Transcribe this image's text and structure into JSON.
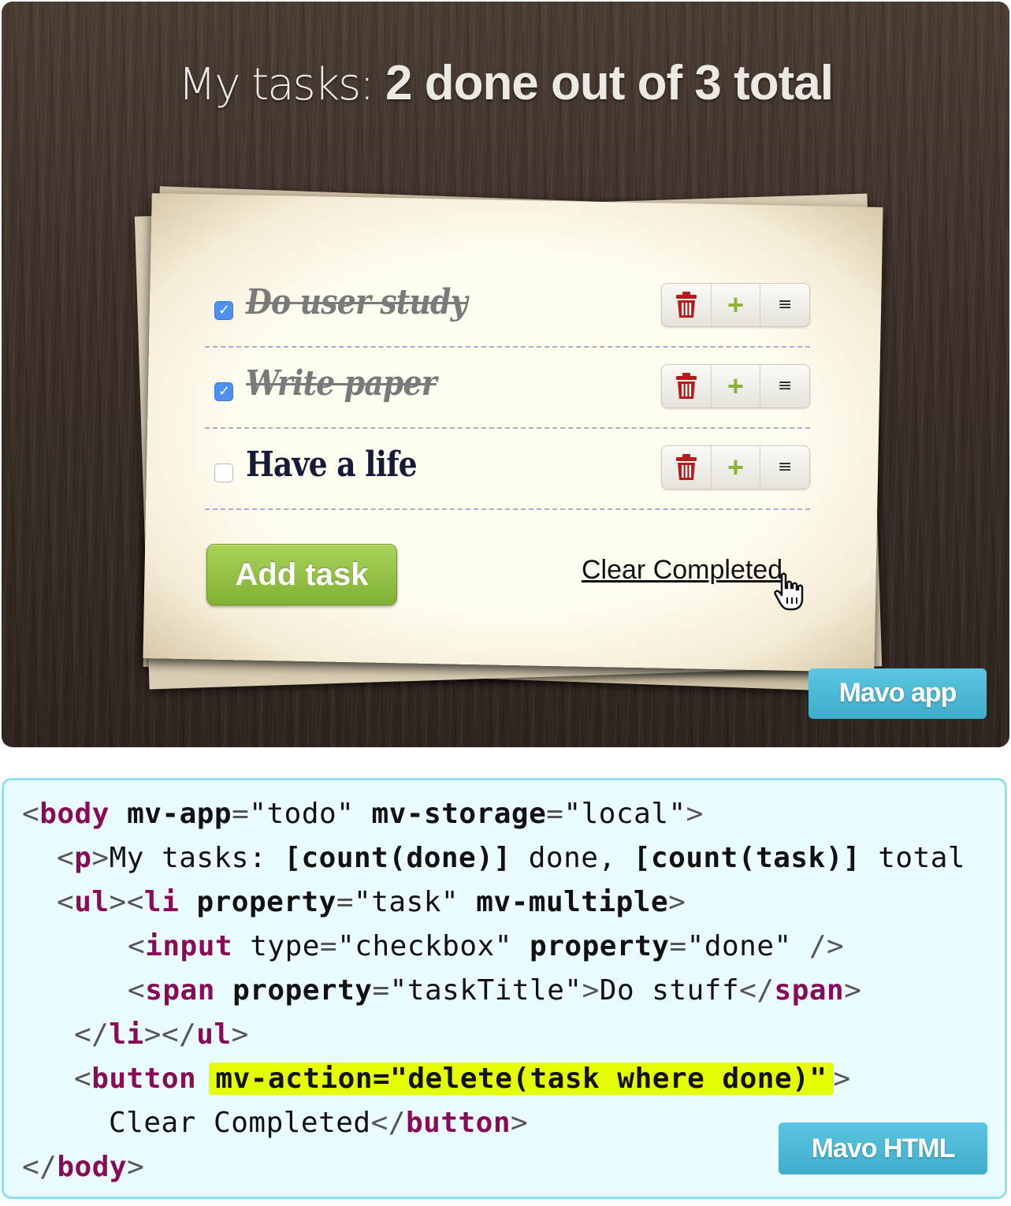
{
  "app": {
    "headline": {
      "prefix": "My tasks: ",
      "done_count": "2",
      "middle": " done out of ",
      "total_count": "3",
      "suffix": " total"
    },
    "tasks": [
      {
        "title": "Do user study",
        "done": true
      },
      {
        "title": "Write paper",
        "done": true
      },
      {
        "title": "Have a life",
        "done": false
      }
    ],
    "task_actions": {
      "delete_icon": "trash-icon",
      "add_icon": "+",
      "menu_icon": "≡"
    },
    "add_button_label": "Add task",
    "clear_link_label": "Clear Completed",
    "badge_label": "Mavo app",
    "colors": {
      "add_button": "#8bbf3e",
      "checkbox_checked": "#4f8ff0",
      "trash": "#b71c1c",
      "plus": "#8bb33a",
      "badge": "#4bb8d4"
    }
  },
  "code": {
    "badge_label": "Mavo HTML",
    "highlight_color": "#e6ff00",
    "l1": {
      "open": "<",
      "tag": "body",
      "a1": " mv-app",
      "eq1": "=",
      "v1": "\"todo\"",
      "a2": " mv-storage",
      "eq2": "=",
      "v2": "\"local\"",
      "close": ">"
    },
    "l2": {
      "open": "<",
      "tag": "p",
      "close": ">",
      "t1": "My tasks: ",
      "e1": "[count(done)]",
      "t2": " done, ",
      "e2": "[count(task)]",
      "t3": " total"
    },
    "l3": {
      "o1": "<",
      "tag1": "ul",
      "c1": "><",
      "tag2": "li",
      "a1": " property",
      "eq1": "=",
      "v1": "\"task\"",
      "a2": " mv-multiple",
      "close": ">"
    },
    "l4": {
      "open": "<",
      "tag": "input",
      "a1": " type",
      "eq1": "=",
      "v1": "\"checkbox\"",
      "a2": " property",
      "eq2": "=",
      "v2": "\"done\"",
      "close": " />"
    },
    "l5": {
      "open": "<",
      "tag": "span",
      "a1": " property",
      "eq1": "=",
      "v1": "\"taskTitle\"",
      "c1": ">",
      "text": "Do stuff",
      "o2": "</",
      "tag2": "span",
      "close": ">"
    },
    "l6": {
      "o1": "</",
      "tag1": "li",
      "c1": "></",
      "tag2": "ul",
      "close": ">"
    },
    "l7": {
      "open": "<",
      "tag": "button",
      "highlight": "mv-action=\"delete(task where done)\"",
      "close": ">"
    },
    "l8": {
      "text": "Clear Completed",
      "o2": "</",
      "tag": "button",
      "close": ">"
    },
    "l9": {
      "o1": "</",
      "tag": "body",
      "close": ">"
    }
  }
}
